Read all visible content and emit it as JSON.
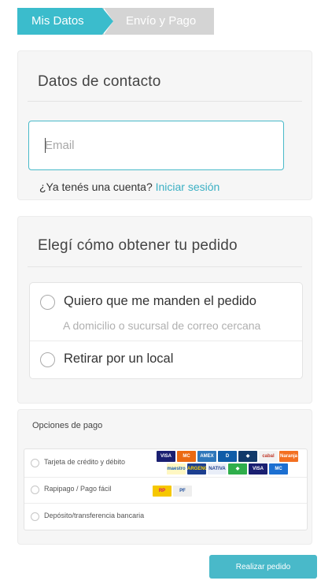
{
  "steps": [
    {
      "label": "Mis Datos",
      "active": true
    },
    {
      "label": "Envío y Pago",
      "active": false
    }
  ],
  "contact": {
    "title": "Datos de contacto",
    "email_placeholder": "Email",
    "email_value": "",
    "account_prompt": "¿Ya tenés una cuenta?",
    "login_link": "Iniciar sesión"
  },
  "delivery": {
    "title": "Elegí cómo obtener tu pedido",
    "options": [
      {
        "label": "Quiero que me manden el pedido",
        "sublabel": "A domicilio o sucursal de correo cercana",
        "selected": false
      },
      {
        "label": "Retirar por un local",
        "sublabel": "",
        "selected": false
      }
    ]
  },
  "payment": {
    "title": "Opciones de pago",
    "methods": [
      {
        "label": "Tarjeta de crédito y débito",
        "selected": false
      },
      {
        "label": "Rapipago / Pago fácil",
        "selected": false
      },
      {
        "label": "Depósito/transferencia bancaria",
        "selected": false
      }
    ],
    "card_logos": [
      {
        "text": "VISA",
        "icon": "visa-logo",
        "bg": "#1a1f71",
        "fg": "#ffffff"
      },
      {
        "text": "MC",
        "icon": "mastercard-logo",
        "bg": "#eb6a12",
        "fg": "#ffffff"
      },
      {
        "text": "AMEX",
        "icon": "amex-logo",
        "bg": "#2e77bb",
        "fg": "#ffffff"
      },
      {
        "text": "D",
        "icon": "diners-logo",
        "bg": "#0f5ca8",
        "fg": "#ffffff"
      },
      {
        "text": "◆",
        "icon": "card-logo",
        "bg": "#123a6b",
        "fg": "#ffffff"
      },
      {
        "text": "cabal",
        "icon": "cabal-logo",
        "bg": "#f2f2f2",
        "fg": "#c0392b"
      },
      {
        "text": "Naranja",
        "icon": "naranja-logo",
        "bg": "#f37021",
        "fg": "#ffffff"
      },
      {
        "text": "maestro",
        "icon": "maestro-logo",
        "bg": "#fff7c2",
        "fg": "#1a5fb4"
      },
      {
        "text": "ARGENCARD",
        "icon": "argencard-logo",
        "bg": "#1d3f8f",
        "fg": "#ffd400"
      },
      {
        "text": "NATIVA",
        "icon": "nativa-logo",
        "bg": "#e9eef8",
        "fg": "#1d3f8f"
      },
      {
        "text": "◆",
        "icon": "card-logo",
        "bg": "#2fae4b",
        "fg": "#ffffff"
      },
      {
        "text": "VISA",
        "icon": "visa-logo",
        "bg": "#1a1f71",
        "fg": "#ffffff"
      },
      {
        "text": "MC",
        "icon": "card-logo",
        "bg": "#1c6fd1",
        "fg": "#ffffff"
      }
    ],
    "cash_logos": [
      {
        "text": "RP",
        "icon": "rapipago-logo",
        "bg": "#f6c700",
        "fg": "#d6166b"
      },
      {
        "text": "PF",
        "icon": "pagofacil-logo",
        "bg": "#eeeeee",
        "fg": "#1a4c9c"
      }
    ]
  },
  "submit_label": "Realizar pedido",
  "colors": {
    "accent": "#49b9c9",
    "panel_bg": "#f6f6f6",
    "step_inactive": "#d4d4d4"
  }
}
